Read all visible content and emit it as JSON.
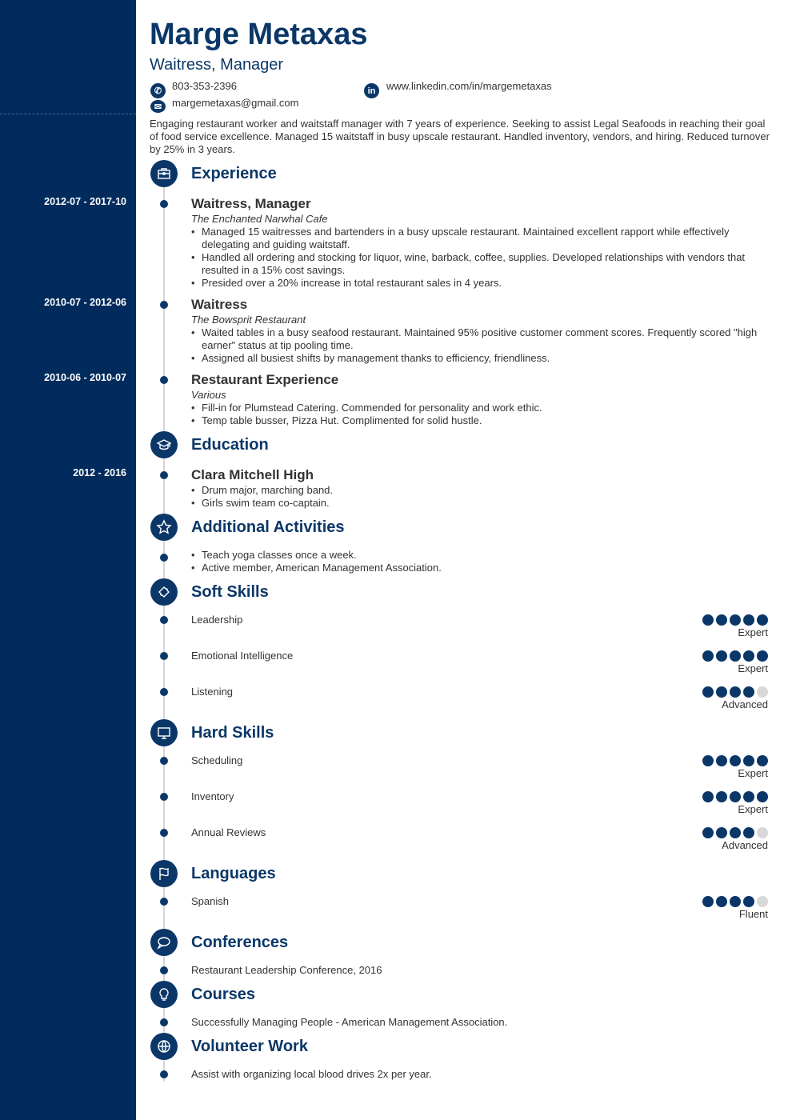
{
  "header": {
    "name": "Marge Metaxas",
    "role": "Waitress, Manager",
    "phone": "803-353-2396",
    "email": "margemetaxas@gmail.com",
    "linkedin": "www.linkedin.com/in/margemetaxas",
    "summary": "Engaging restaurant worker and waitstaff manager with 7 years of experience. Seeking to assist Legal Seafoods in reaching their goal of food service excellence. Managed 15 waitstaff in busy upscale restaurant. Handled inventory, vendors, and hiring. Reduced turnover by 25% in 3 years."
  },
  "colors": {
    "sidebar": "#002b5c",
    "accent": "#0b3768"
  },
  "experience": {
    "title": "Experience",
    "icon": "briefcase-icon",
    "items": [
      {
        "dates": "2012-07 - 2017-10",
        "title": "Waitress, Manager",
        "company": "The Enchanted Narwhal Cafe",
        "bullets": [
          "Managed 15 waitresses and bartenders in a busy upscale restaurant. Maintained excellent rapport while effectively delegating and guiding waitstaff.",
          "Handled all ordering and stocking for liquor, wine, barback, coffee, supplies. Developed relationships with vendors that resulted in a 15% cost savings.",
          "Presided over a 20% increase in total restaurant sales in 4 years."
        ]
      },
      {
        "dates": "2010-07 - 2012-06",
        "title": "Waitress",
        "company": "The Bowsprit Restaurant",
        "bullets": [
          "Waited tables in a busy seafood restaurant. Maintained 95% positive customer comment scores. Frequently scored \"high earner\" status at tip pooling time.",
          "Assigned all busiest shifts by management thanks to efficiency, friendliness."
        ]
      },
      {
        "dates": "2010-06 - 2010-07",
        "title": "Restaurant Experience",
        "company": "Various",
        "bullets": [
          "Fill-in for Plumstead Catering. Commended for personality and work ethic.",
          "Temp table busser, Pizza Hut. Complimented for solid hustle."
        ]
      }
    ]
  },
  "education": {
    "title": "Education",
    "icon": "graduation-cap-icon",
    "items": [
      {
        "dates": "2012 - 2016",
        "title": "Clara Mitchell High",
        "bullets": [
          "Drum major, marching band.",
          "Girls swim team co-captain."
        ]
      }
    ]
  },
  "activities": {
    "title": "Additional Activities",
    "icon": "star-icon",
    "bullets": [
      "Teach yoga classes once a week.",
      "Active member, American Management Association."
    ]
  },
  "soft_skills": {
    "title": "Soft Skills",
    "icon": "puzzle-icon",
    "items": [
      {
        "name": "Leadership",
        "level": "Expert",
        "rating": 5
      },
      {
        "name": "Emotional Intelligence",
        "level": "Expert",
        "rating": 5
      },
      {
        "name": "Listening",
        "level": "Advanced",
        "rating": 4
      }
    ]
  },
  "hard_skills": {
    "title": "Hard Skills",
    "icon": "monitor-icon",
    "items": [
      {
        "name": "Scheduling",
        "level": "Expert",
        "rating": 5
      },
      {
        "name": "Inventory",
        "level": "Expert",
        "rating": 5
      },
      {
        "name": "Annual Reviews",
        "level": "Advanced",
        "rating": 4
      }
    ]
  },
  "languages": {
    "title": "Languages",
    "icon": "flag-icon",
    "items": [
      {
        "name": "Spanish",
        "level": "Fluent",
        "rating": 4
      }
    ]
  },
  "conferences": {
    "title": "Conferences",
    "icon": "speech-bubble-icon",
    "text": "Restaurant Leadership Conference, 2016"
  },
  "courses": {
    "title": "Courses",
    "icon": "lightbulb-icon",
    "text": "Successfully Managing People - American Management Association."
  },
  "volunteer": {
    "title": "Volunteer Work",
    "icon": "globe-icon",
    "text": "Assist with organizing local blood drives 2x per year."
  }
}
